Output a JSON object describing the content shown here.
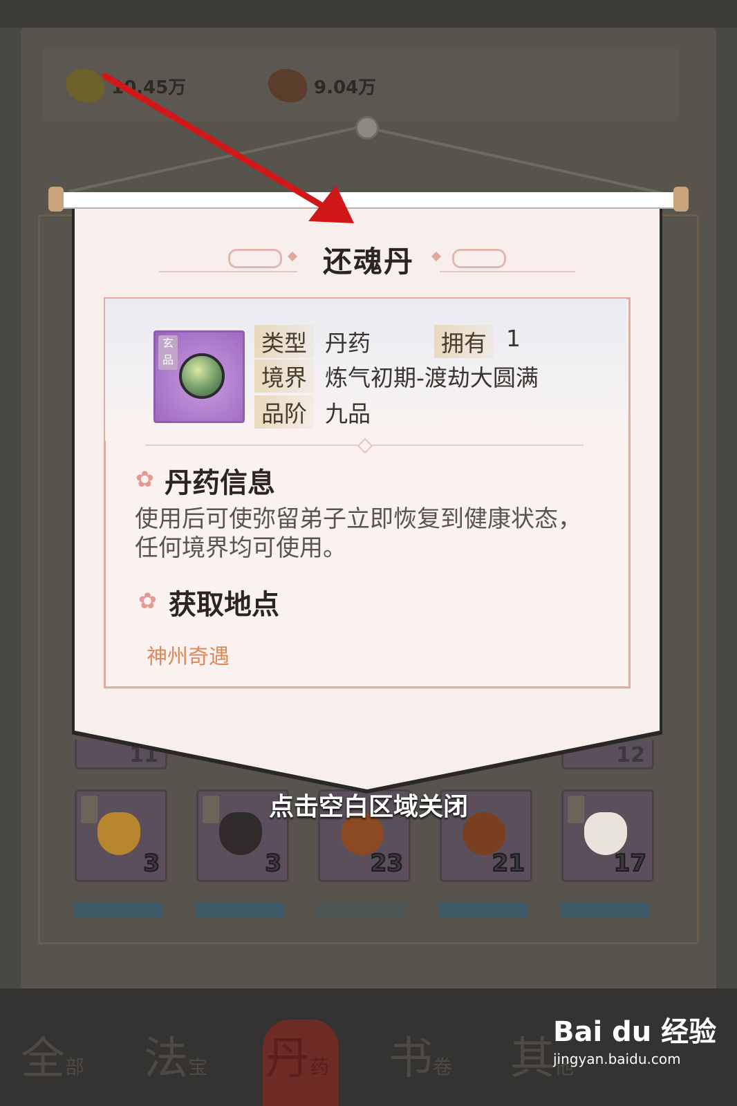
{
  "resources": [
    {
      "value": "10.45万",
      "icon": "ore-gold-icon",
      "color": "#6d6229"
    },
    {
      "value": "9.04万",
      "icon": "ore-copper-icon",
      "color": "#5a3d2a"
    }
  ],
  "popup": {
    "title": "还魂丹",
    "item": {
      "grade_badge": "玄品",
      "icon": "pill-icon"
    },
    "attributes": {
      "type_label": "类型",
      "type_value": "丹药",
      "own_label": "拥有",
      "own_value": "1",
      "realm_label": "境界",
      "realm_value": "炼气初期-渡劫大圆满",
      "rank_label": "品阶",
      "rank_value": "九品"
    },
    "info_section": {
      "title": "丹药信息",
      "description": "使用后可使弥留弟子立即恢复到健康状态，任何境界均可使用。"
    },
    "source_section": {
      "title": "获取地点",
      "sources": [
        "神州奇遇"
      ]
    },
    "close_hint": "点击空白区域关闭"
  },
  "inventory": {
    "partial_counts": [
      "11",
      "12"
    ],
    "slots": [
      {
        "count": "3",
        "color": "#b8862f"
      },
      {
        "count": "3",
        "color": "#2f2b2c"
      },
      {
        "count": "23",
        "color": "#8c4a24"
      },
      {
        "count": "21",
        "color": "#7a3e20"
      },
      {
        "count": "17",
        "color": "#e8e4dc"
      }
    ]
  },
  "nav": [
    {
      "label": "全",
      "sub": "部"
    },
    {
      "label": "法",
      "sub": "宝"
    },
    {
      "label": "丹",
      "sub": "药"
    },
    {
      "label": "书",
      "sub": "卷"
    },
    {
      "label": "其",
      "sub": "他"
    }
  ],
  "watermark": {
    "logo": "Bai du 经验",
    "url": "jingyan.baidu.com"
  },
  "colors": {
    "accent_border": "#e3aaa2",
    "source_link": "#d9895a",
    "arrow": "#d01818"
  }
}
